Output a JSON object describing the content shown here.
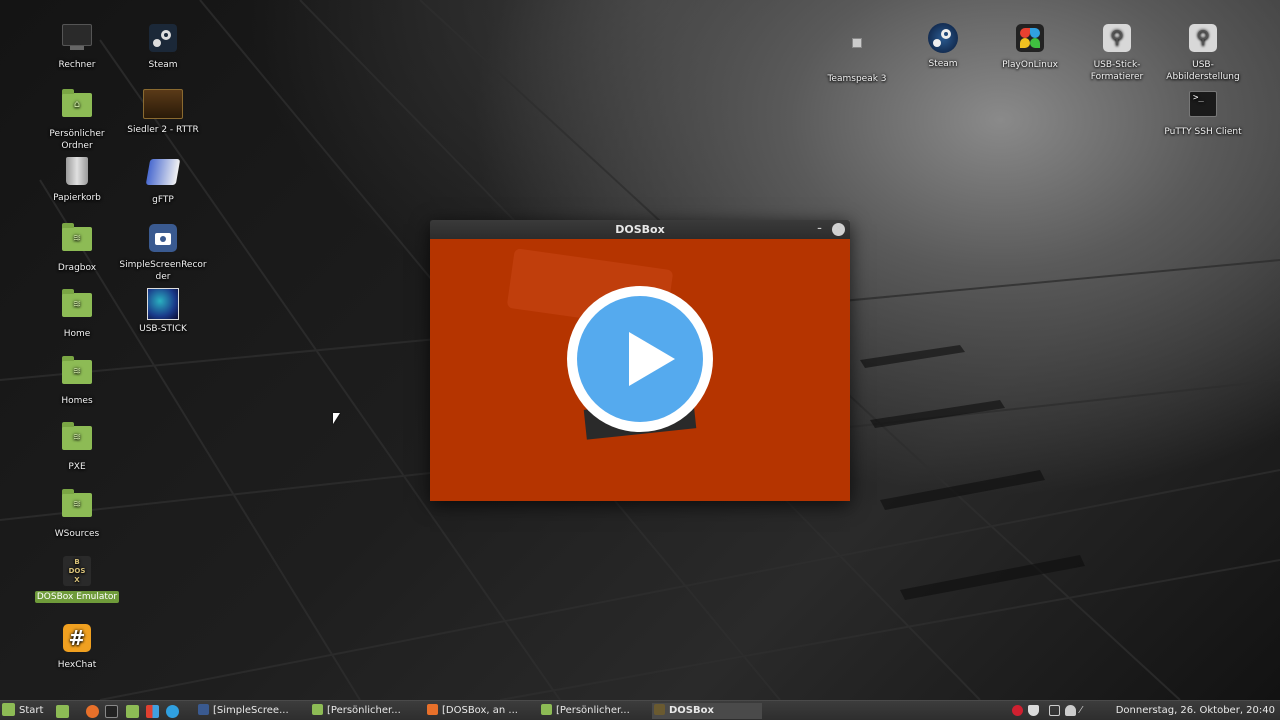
{
  "desktop": {
    "left_icons": [
      {
        "label": "Rechner",
        "icon": "computer-icon"
      },
      {
        "label": "Persönlicher Ordner",
        "icon": "home-folder-icon"
      },
      {
        "label": "Papierkorb",
        "icon": "trash-icon"
      },
      {
        "label": "Dragbox",
        "icon": "network-folder-icon"
      },
      {
        "label": "Home",
        "icon": "network-folder-icon"
      },
      {
        "label": "Homes",
        "icon": "network-folder-icon"
      },
      {
        "label": "PXE",
        "icon": "network-folder-icon"
      },
      {
        "label": "WSources",
        "icon": "network-folder-icon"
      },
      {
        "label": "DOSBox Emulator",
        "icon": "dosbox-icon"
      },
      {
        "label": "HexChat",
        "icon": "hexchat-icon"
      }
    ],
    "second_icons": [
      {
        "label": "Steam",
        "icon": "steam-icon"
      },
      {
        "label": "Siedler 2 - RTTR",
        "icon": "siedler-icon"
      },
      {
        "label": "gFTP",
        "icon": "gftp-icon"
      },
      {
        "label": "SimpleScreenRecorder",
        "icon": "screen-recorder-icon"
      },
      {
        "label": "USB-STICK",
        "icon": "usb-drive-icon"
      }
    ],
    "right_icons": [
      {
        "label": "Teamspeak 3",
        "icon": "teamspeak-icon"
      },
      {
        "label": "Steam",
        "icon": "steam-icon"
      },
      {
        "label": "PlayOnLinux",
        "icon": "playonlinux-icon"
      },
      {
        "label": "USB-Stick-Formatierer",
        "icon": "usb-icon"
      },
      {
        "label": "USB-Abbilderstellung",
        "icon": "usb-icon"
      },
      {
        "label": "PuTTY SSH Client",
        "icon": "putty-icon"
      }
    ],
    "selected_label": "DOSBox Emulator"
  },
  "window": {
    "title": "DOSBox",
    "minimize_glyph": "–",
    "close_glyph": "✕",
    "content_color": "#b53400",
    "play_icon": "play-icon"
  },
  "taskbar": {
    "start_label": "Start",
    "tasks": [
      {
        "label": "[SimpleScree...",
        "active": false
      },
      {
        "label": "[Persönlicher...",
        "active": false
      },
      {
        "label": "[DOSBox, an ...",
        "active": false
      },
      {
        "label": "[Persönlicher...",
        "active": false
      },
      {
        "label": "DOSBox",
        "active": true
      }
    ],
    "clock": "Donnerstag, 26. Oktober, 20:40"
  },
  "colors": {
    "accent": "#8dbb55",
    "selection": "#6f9b3a",
    "play_blue": "#55aaee"
  }
}
